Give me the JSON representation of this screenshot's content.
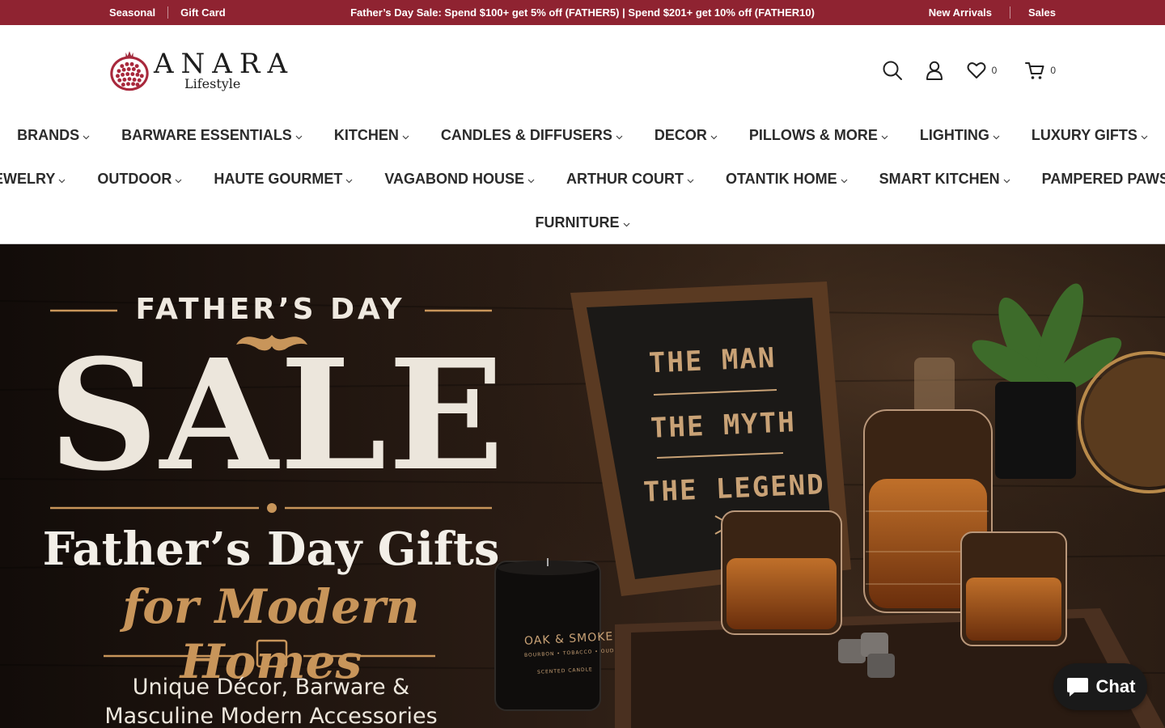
{
  "topbar": {
    "left_links": [
      "Seasonal",
      "Gift Card"
    ],
    "promo": "Father’s Day Sale: Spend $100+ get 5% off (FATHER5) | Spend $201+ get 10% off (FATHER10)",
    "right_links": [
      "New Arrivals",
      "Sales"
    ],
    "background": "#8f2331"
  },
  "header": {
    "logo": {
      "brand": "ANARA",
      "sub": "Lifestyle",
      "icon": "pomegranate-logo"
    },
    "icons": {
      "search": "search-icon",
      "account": "user-icon",
      "wishlist": {
        "icon": "heart-icon",
        "count": "0"
      },
      "cart": {
        "icon": "cart-icon",
        "count": "0"
      }
    }
  },
  "nav": {
    "row1": [
      "BRANDS",
      "BARWARE ESSENTIALS",
      "KITCHEN",
      "CANDLES & DIFFUSERS",
      "DECOR",
      "PILLOWS & MORE",
      "LIGHTING",
      "LUXURY GIFTS"
    ],
    "row2": [
      "JEWELRY",
      "OUTDOOR",
      "HAUTE GOURMET",
      "VAGABOND HOUSE",
      "ARTHUR COURT",
      "OTANTIK HOME",
      "SMART KITCHEN",
      "PAMPERED PAWS"
    ],
    "row3": [
      "FURNITURE"
    ]
  },
  "hero": {
    "eyebrow": "FATHER’S DAY",
    "headline": "SALE",
    "title": "Father’s Day Gifts",
    "script": "for Modern Homes",
    "desc_line1": "Unique Décor, Barware &",
    "desc_line2": "Masculine Modern Accessories",
    "sign": [
      "THE MAN",
      "THE MYTH",
      "THE LEGEND"
    ],
    "candle": [
      "OAK & SMOKE",
      "BOURBON • TOBACCO • OUD",
      "SCENTED CANDLE"
    ],
    "accent": "#c8955a"
  },
  "chat": {
    "label": "Chat",
    "icon": "chat-bubble-icon"
  }
}
